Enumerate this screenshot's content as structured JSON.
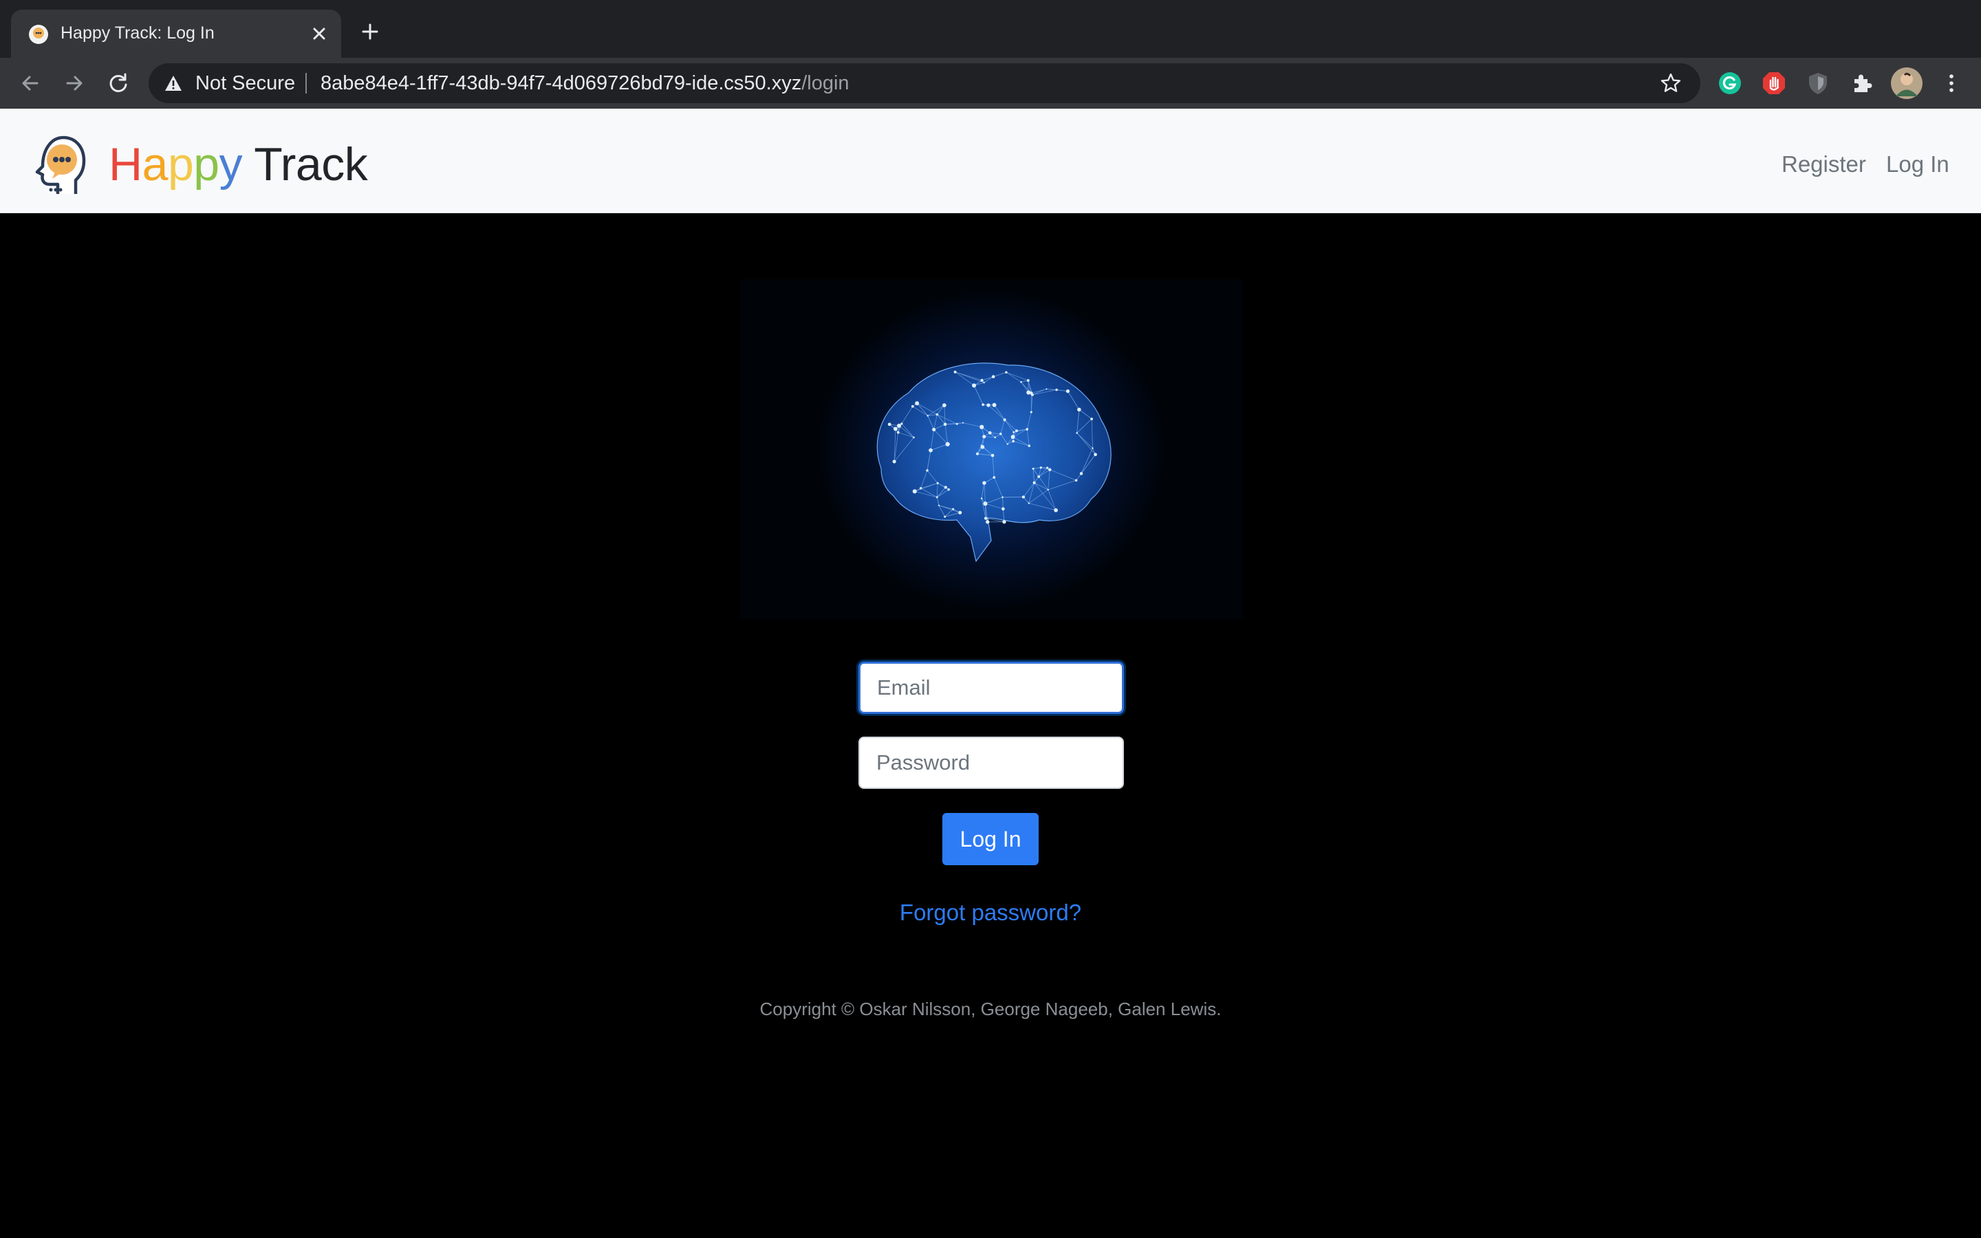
{
  "browser": {
    "tab_title": "Happy Track: Log In",
    "security_label": "Not Secure",
    "url_host": "8abe84e4-1ff7-43db-94f7-4d069726bd79-ide.cs50.xyz",
    "url_path": "/login"
  },
  "navbar": {
    "brand_letters": [
      "H",
      "a",
      "p",
      "p",
      "y"
    ],
    "brand_rest": " Track",
    "links": {
      "register": "Register",
      "login": "Log In"
    }
  },
  "form": {
    "email_placeholder": "Email",
    "password_placeholder": "Password",
    "submit_label": "Log In",
    "forgot_label": "Forgot password?"
  },
  "footer": {
    "copyright": "Copyright © Oskar Nilsson, George Nageeb, Galen Lewis."
  },
  "colors": {
    "accent": "#2d7cf6",
    "navbar_bg": "#f8f9fa",
    "page_bg": "#000000"
  }
}
